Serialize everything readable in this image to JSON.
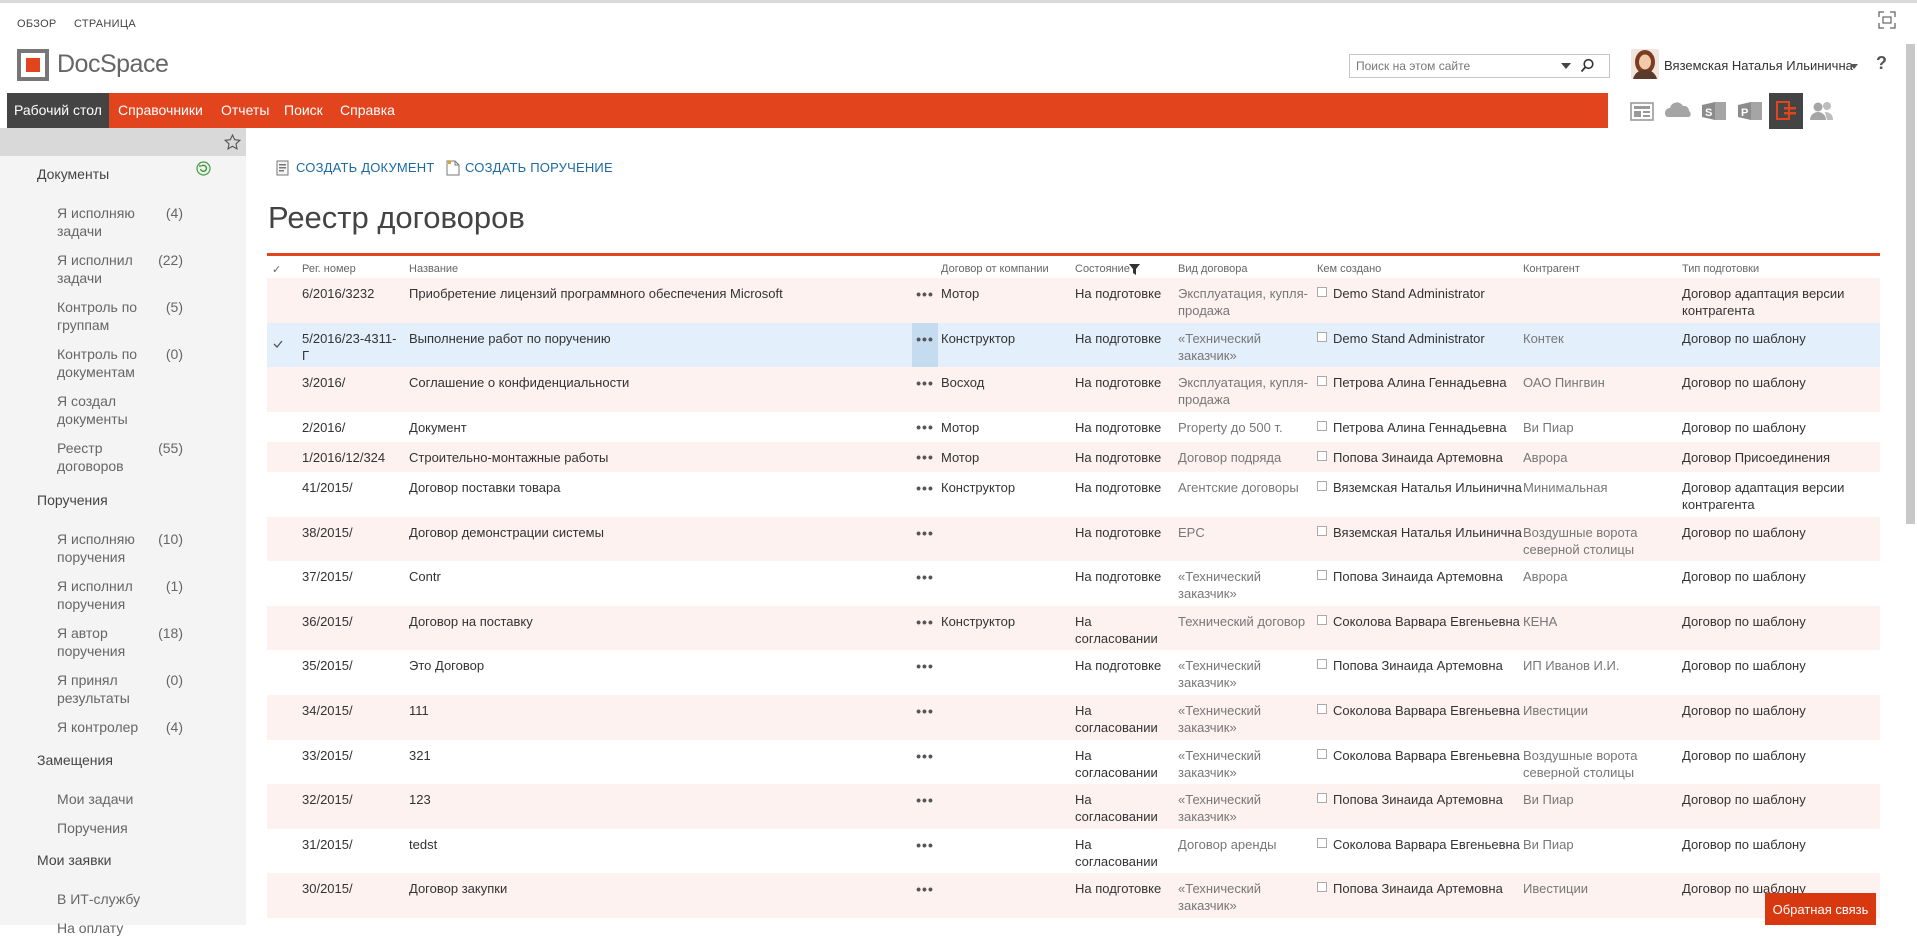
{
  "ribbon": {
    "tabs": [
      "ОБЗОР",
      "СТРАНИЦА"
    ]
  },
  "header": {
    "logo_text": "DocSpace",
    "search_placeholder": "Поиск на этом сайте",
    "user_name": "Вяземская Наталья Ильинична",
    "help": "?"
  },
  "nav": {
    "items": [
      "Рабочий стол",
      "Справочники",
      "Отчеты",
      "Поиск",
      "Справка"
    ],
    "active": "Рабочий стол"
  },
  "app_icons": [
    "newsfeed-icon",
    "onedrive-icon",
    "sites-icon",
    "project-icon",
    "docspace-icon",
    "people-icon"
  ],
  "sidebar": {
    "sections": [
      {
        "title": "Документы",
        "items": [
          {
            "label": "Я исполняю задачи",
            "count": "(4)"
          },
          {
            "label": "Я исполнил задачи",
            "count": "(22)"
          },
          {
            "label": "Контроль по группам",
            "count": "(5)"
          },
          {
            "label": "Контроль по документам",
            "count": "(0)"
          },
          {
            "label": "Я создал документы",
            "count": ""
          },
          {
            "label": "Реестр договоров",
            "count": "(55)"
          }
        ]
      },
      {
        "title": "Поручения",
        "items": [
          {
            "label": "Я исполняю поручения",
            "count": "(10)"
          },
          {
            "label": "Я исполнил поручения",
            "count": "(1)"
          },
          {
            "label": "Я автор поручения",
            "count": "(18)"
          },
          {
            "label": "Я принял результаты",
            "count": "(0)"
          },
          {
            "label": "Я контролер",
            "count": "(4)"
          }
        ]
      },
      {
        "title": "Замещения",
        "items": [
          {
            "label": "Мои задачи",
            "count": ""
          },
          {
            "label": "Поручения",
            "count": ""
          }
        ]
      },
      {
        "title": "Мои заявки",
        "items": [
          {
            "label": "В ИТ-службу",
            "count": ""
          },
          {
            "label": "На оплату",
            "count": ""
          }
        ]
      }
    ]
  },
  "actions": {
    "create_document": "СОЗДАТЬ ДОКУМЕНТ",
    "create_assignment": "СОЗДАТЬ ПОРУЧЕНИЕ"
  },
  "page_title": "Реестр договоров",
  "table": {
    "columns": {
      "check": "✓",
      "reg_num": "Рег. номер",
      "name": "Название",
      "company": "Договор от компании",
      "state": "Состояние",
      "type": "Вид договора",
      "author": "Кем создано",
      "counterparty": "Контрагент",
      "prep_type": "Тип подготовки"
    },
    "rows": [
      {
        "reg": "6/2016/3232",
        "name": "Приобретение лицензий программного обеспечения Microsoft",
        "company": "Мотор",
        "state": "На подготовке",
        "type": "Эксплуатация, купля-продажа",
        "author": "Demo Stand Administrator",
        "counterparty": "",
        "prep": "Договор адаптация версии контрагента"
      },
      {
        "reg": "5/2016/23-4311-Г",
        "name": "Выполнение работ по поручению",
        "company": "Конструктор",
        "state": "На подготовке",
        "type": "«Технический заказчик»",
        "author": "Demo Stand Administrator",
        "counterparty": "Контек",
        "prep": "Договор по шаблону",
        "selected": true
      },
      {
        "reg": "3/2016/",
        "name": "Соглашение о конфиденциальности",
        "company": "Восход",
        "state": "На подготовке",
        "type": "Эксплуатация, купля-продажа",
        "author": "Петрова Алина Геннадьевна",
        "counterparty": "ОАО Пингвин",
        "prep": "Договор по шаблону"
      },
      {
        "reg": "2/2016/",
        "name": "Документ",
        "company": "Мотор",
        "state": "На подготовке",
        "type": "Property до 500 т.",
        "author": "Петрова Алина Геннадьевна",
        "counterparty": "Ви Пиар",
        "prep": "Договор по шаблону"
      },
      {
        "reg": "1/2016/12/324",
        "name": "Строительно-монтажные работы",
        "company": "Мотор",
        "state": "На подготовке",
        "type": "Договор подряда",
        "author": "Попова Зинаида Артемовна",
        "counterparty": "Аврора",
        "prep": "Договор Присоединения"
      },
      {
        "reg": "41/2015/",
        "name": "Договор поставки товара",
        "company": "Конструктор",
        "state": "На подготовке",
        "type": "Агентские договоры",
        "author": "Вяземская Наталья Ильинична",
        "counterparty": "Минимальная",
        "prep": "Договор адаптация версии контрагента"
      },
      {
        "reg": "38/2015/",
        "name": "Договор демонстрации системы",
        "company": "",
        "state": "На подготовке",
        "type": "EPC",
        "author": "Вяземская Наталья Ильинична",
        "counterparty": "Воздушные ворота северной столицы",
        "prep": "Договор по шаблону"
      },
      {
        "reg": "37/2015/",
        "name": "Contr",
        "company": "",
        "state": "На подготовке",
        "type": "«Технический заказчик»",
        "author": "Попова Зинаида Артемовна",
        "counterparty": "Аврора",
        "prep": "Договор по шаблону"
      },
      {
        "reg": "36/2015/",
        "name": "Договор на поставку",
        "company": "Конструктор",
        "state": "На согласовании",
        "type": "Технический договор",
        "author": "Соколова Варвара Евгеньевна",
        "counterparty": "КЕНА",
        "prep": "Договор по шаблону"
      },
      {
        "reg": "35/2015/",
        "name": "Это Договор",
        "company": "",
        "state": "На подготовке",
        "type": "«Технический заказчик»",
        "author": "Попова Зинаида Артемовна",
        "counterparty": "ИП Иванов И.И.",
        "prep": "Договор по шаблону"
      },
      {
        "reg": "34/2015/",
        "name": "111",
        "company": "",
        "state": "На согласовании",
        "type": "«Технический заказчик»",
        "author": "Соколова Варвара Евгеньевна",
        "counterparty": "Ивестиции",
        "prep": "Договор по шаблону"
      },
      {
        "reg": "33/2015/",
        "name": "321",
        "company": "",
        "state": "На согласовании",
        "type": "«Технический заказчик»",
        "author": "Соколова Варвара Евгеньевна",
        "counterparty": "Воздушные ворота северной столицы",
        "prep": "Договор по шаблону"
      },
      {
        "reg": "32/2015/",
        "name": "123",
        "company": "",
        "state": "На согласовании",
        "type": "«Технический заказчик»",
        "author": "Попова Зинаида Артемовна",
        "counterparty": "Ви Пиар",
        "prep": "Договор по шаблону"
      },
      {
        "reg": "31/2015/",
        "name": "tedst",
        "company": "",
        "state": "На согласовании",
        "type": "Договор аренды",
        "author": "Соколова Варвара Евгеньевна",
        "counterparty": "Ви Пиар",
        "prep": "Договор по шаблону"
      },
      {
        "reg": "30/2015/",
        "name": "Договор закупки",
        "company": "",
        "state": "На подготовке",
        "type": "«Технический заказчик»",
        "author": "Попова Зинаида Артемовна",
        "counterparty": "Ивестиции",
        "prep": "Договор по шаблону"
      }
    ]
  },
  "feedback": "Обратная связь",
  "colors": {
    "accent": "#e2451e",
    "nav_active": "#444444",
    "link": "#1b6aa5",
    "selected_row": "#e3effa",
    "alt_row": "#fdf2f0"
  }
}
